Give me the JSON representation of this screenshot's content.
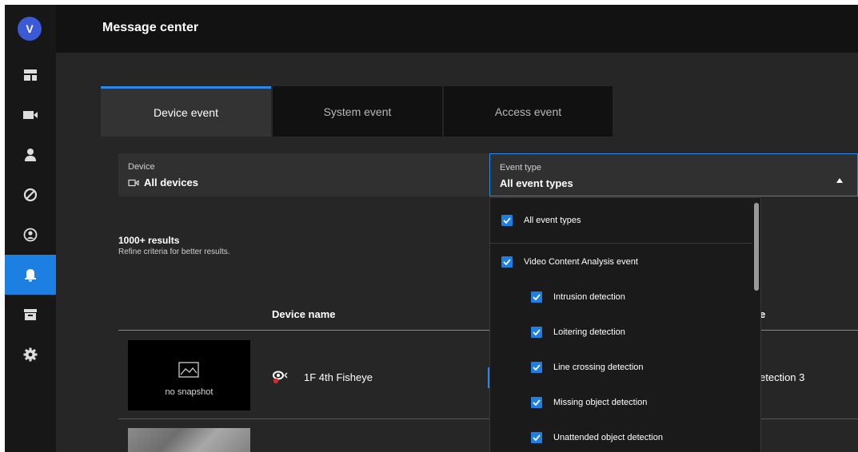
{
  "app": {
    "avatar_letter": "V",
    "page_title": "Message center"
  },
  "sidebar": {
    "items": [
      {
        "icon": "dashboard-icon",
        "active": false
      },
      {
        "icon": "video-camera-icon",
        "active": false
      },
      {
        "icon": "person-icon",
        "active": false
      },
      {
        "icon": "no-entry-icon",
        "active": false
      },
      {
        "icon": "user-circle-icon",
        "active": false
      },
      {
        "icon": "bell-icon",
        "active": true
      },
      {
        "icon": "archive-icon",
        "active": false
      },
      {
        "icon": "gear-icon",
        "active": false
      }
    ],
    "active_color": "#1e7fe3"
  },
  "tabs": [
    {
      "label": "Device event",
      "active": true
    },
    {
      "label": "System event",
      "active": false
    },
    {
      "label": "Access event",
      "active": false
    }
  ],
  "filters": {
    "device": {
      "label": "Device",
      "value": "All devices"
    },
    "event_type": {
      "label": "Event type",
      "value": "All event types"
    }
  },
  "results": {
    "count": "1000+ results",
    "hint": "Refine criteria for better results."
  },
  "table": {
    "columns": {
      "device_name": "Device name",
      "partial": "e"
    },
    "rows": [
      {
        "snapshot_text": "no snapshot",
        "device": "1F 4th Fisheye",
        "partial_cell": "etection 3"
      }
    ]
  },
  "dropdown": {
    "items": [
      {
        "label": "All event types",
        "checked": true,
        "indent": 0
      },
      {
        "label": "Video Content Analysis event",
        "checked": true,
        "indent": 0
      },
      {
        "label": "Intrusion detection",
        "checked": true,
        "indent": 1
      },
      {
        "label": "Loitering detection",
        "checked": true,
        "indent": 1
      },
      {
        "label": "Line crossing detection",
        "checked": true,
        "indent": 1
      },
      {
        "label": "Missing object detection",
        "checked": true,
        "indent": 1
      },
      {
        "label": "Unattended object detection",
        "checked": true,
        "indent": 1
      }
    ]
  },
  "colors": {
    "accent": "#2b88e9",
    "checkbox": "#1e7fe3",
    "background": "#262626"
  }
}
